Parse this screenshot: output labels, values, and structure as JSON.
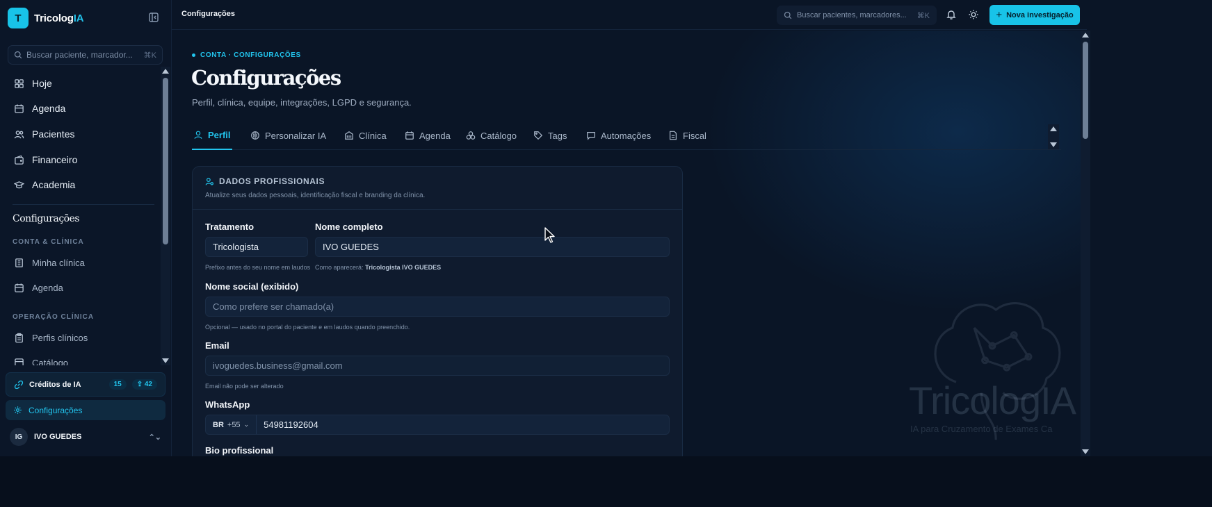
{
  "brand": {
    "logo_letter": "T",
    "name_prefix": "Tricolog",
    "name_accent": "IA"
  },
  "sidebar": {
    "search_placeholder": "Buscar paciente, marcador...",
    "search_shortcut": "⌘K",
    "items": [
      {
        "label": "Hoje",
        "icon": "grid-icon"
      },
      {
        "label": "Agenda",
        "icon": "calendar-icon"
      },
      {
        "label": "Pacientes",
        "icon": "users-icon"
      },
      {
        "label": "Financeiro",
        "icon": "wallet-icon"
      },
      {
        "label": "Academia",
        "icon": "graduation-cap-icon"
      }
    ],
    "settings_heading": "Configurações",
    "section_account": "CONTA & CLÍNICA",
    "account_items": [
      {
        "label": "Minha clínica",
        "icon": "clinic-icon"
      },
      {
        "label": "Agenda",
        "icon": "calendar-icon"
      }
    ],
    "section_clinical": "OPERAÇÃO CLÍNICA",
    "clinical_items": [
      {
        "label": "Perfis clínicos",
        "icon": "clipboard-icon"
      },
      {
        "label": "Catálogo",
        "icon": "catalog-icon"
      }
    ],
    "credits": {
      "label": "Créditos de IA",
      "badge_a": "15",
      "badge_b": "42"
    },
    "settings_label": "Configurações",
    "user": {
      "initials": "IG",
      "name": "IVO GUEDES"
    }
  },
  "topbar": {
    "breadcrumb": "Configurações",
    "search_placeholder": "Buscar pacientes, marcadores...",
    "search_shortcut": "⌘K",
    "cta": "Nova investigação"
  },
  "page": {
    "eyebrow": "CONTA · CONFIGURAÇÕES",
    "title": "Configurações",
    "subtitle": "Perfil, clínica, equipe, integrações, LGPD e segurança.",
    "tabs": [
      {
        "label": "Perfil",
        "icon": "user-icon",
        "active": true
      },
      {
        "label": "Personalizar IA",
        "icon": "brain-icon"
      },
      {
        "label": "Clínica",
        "icon": "building-icon"
      },
      {
        "label": "Agenda",
        "icon": "calendar-icon"
      },
      {
        "label": "Catálogo",
        "icon": "catalog-icon"
      },
      {
        "label": "Tags",
        "icon": "tag-icon"
      },
      {
        "label": "Automações",
        "icon": "message-icon"
      },
      {
        "label": "Fiscal",
        "icon": "document-icon"
      }
    ]
  },
  "card": {
    "title": "DADOS PROFISSIONAIS",
    "description": "Atualize seus dados pessoais, identificação fiscal e branding da clínica.",
    "treatment_label": "Tratamento",
    "treatment_value": "Tricologista",
    "treatment_hint": "Prefixo antes do seu nome em laudos",
    "fullname_label": "Nome completo",
    "fullname_value": "IVO GUEDES",
    "fullname_hint_prefix": "Como aparecerá:",
    "fullname_hint_value": "Tricologista IVO GUEDES",
    "social_label": "Nome social (exibido)",
    "social_placeholder": "Como prefere ser chamado(a)",
    "social_hint": "Opcional — usado no portal do paciente e em laudos quando preenchido.",
    "email_label": "Email",
    "email_value": "ivoguedes.business@gmail.com",
    "email_hint": "Email não pode ser alterado",
    "whatsapp_label": "WhatsApp",
    "whatsapp_country": "BR",
    "whatsapp_code": "+55",
    "whatsapp_number": "54981192604",
    "bio_label": "Bio profissional"
  },
  "watermark": {
    "name": "TricologIA",
    "tagline": "IA para Cruzamento de Exames Ca"
  },
  "colors": {
    "accent": "#22c5ee",
    "background": "#0a1526",
    "card": "#0f1b2e"
  }
}
